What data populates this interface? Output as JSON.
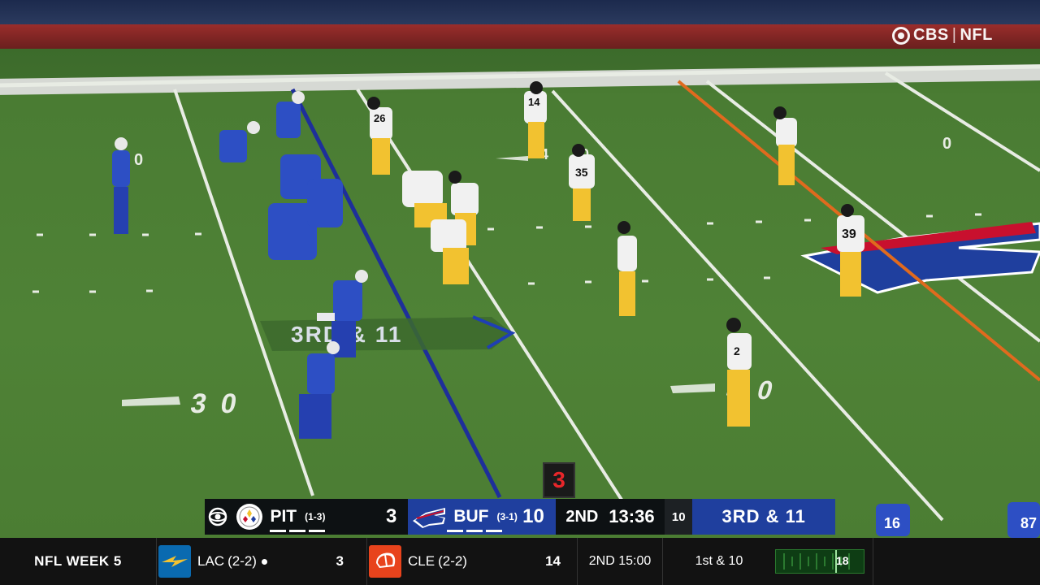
{
  "broadcast": {
    "network_label": "CBS",
    "league_label": "NFL",
    "divider": "|"
  },
  "field": {
    "yard_numbers": [
      "30",
      "40",
      "0",
      "0",
      "40"
    ],
    "down_graphic_text": "3RD & 11",
    "down_marker_number": "3",
    "colors": {
      "line_of_scrimmage": "#1e2f9a",
      "first_down_line": "#e06a1e",
      "grass": "#4f8236"
    }
  },
  "players": {
    "jersey_numbers": [
      "26",
      "14",
      "35",
      "39",
      "2",
      "16",
      "87"
    ]
  },
  "scoreboard": {
    "away": {
      "abbr": "PIT",
      "record": "(1-3)",
      "score": "3",
      "color": "#0d1113"
    },
    "home": {
      "abbr": "BUF",
      "record": "(3-1)",
      "score": "10",
      "color": "#1f3f9e"
    },
    "quarter": "2ND",
    "clock": "13:36",
    "play_clock": "10",
    "down_distance": "3RD & 11"
  },
  "ticker": {
    "week_label": "NFL WEEK 5",
    "game": {
      "away": {
        "abbr": "LAC",
        "record": "(2-2)",
        "score": "3",
        "has_possession": true,
        "color": "#0a6ab0"
      },
      "home": {
        "abbr": "CLE",
        "record": "(2-2)",
        "score": "14",
        "color": "#e8431c"
      },
      "status": "2ND 15:00",
      "down_distance": "1st & 10",
      "field_position": "18"
    }
  }
}
